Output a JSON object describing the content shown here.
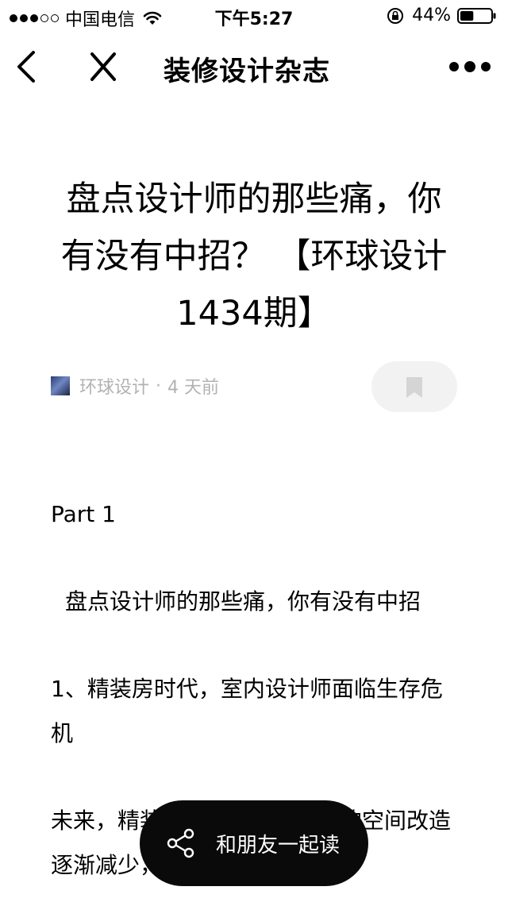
{
  "status_bar": {
    "carrier": "中国电信",
    "time": "下午5:27",
    "battery_percent": "44%",
    "battery_level": 0.44,
    "signal_bars_filled": 3,
    "signal_bars_total": 5,
    "icons": [
      "wifi-icon",
      "rotation-lock-icon",
      "battery-icon"
    ]
  },
  "nav": {
    "title": "装修设计杂志",
    "icons": [
      "back-chevron-icon",
      "close-icon",
      "more-icon"
    ]
  },
  "article": {
    "title": "盘点设计师的那些痛，你有没有中招？ 【环球设计1434期】",
    "author": "环球设计",
    "separator": "·",
    "time_ago": "4 天前",
    "bookmark_icon": "bookmark-icon"
  },
  "content": {
    "part_heading": "Part 1",
    "subheading": "盘点设计师的那些痛，你有没有中招",
    "para1": "1、精装房时代，室内设计师面临生存危机",
    "para2": "未来，精装房时代到来，硬性的空间改造逐渐减少，软性的需求却不"
  },
  "share": {
    "label": "和朋友一起读",
    "icon": "share-icon"
  }
}
